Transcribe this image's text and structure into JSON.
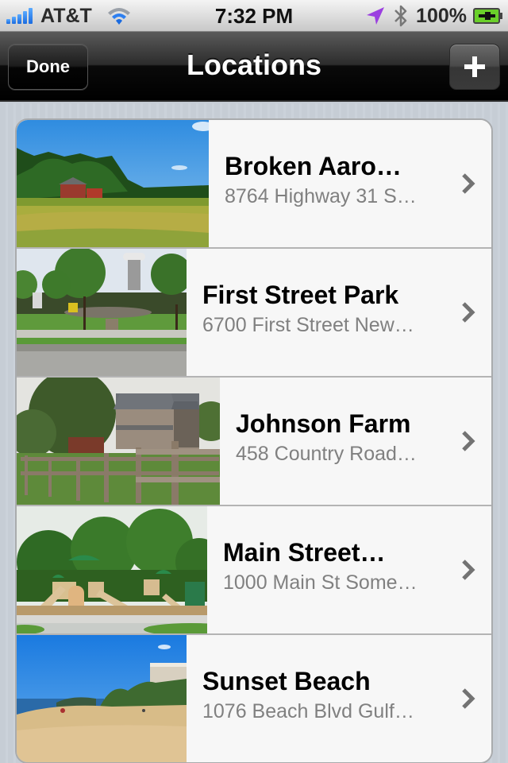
{
  "status_bar": {
    "carrier": "AT&T",
    "time": "7:32 PM",
    "battery_percent": "100%",
    "icons": [
      "signal-bars-icon",
      "wifi-icon",
      "location-arrow-icon",
      "bluetooth-icon",
      "battery-charging-icon"
    ],
    "colors": {
      "signal": "#1a6be0",
      "location": "#9b3fe0",
      "battery": "#5ac81e"
    }
  },
  "nav_bar": {
    "title": "Locations",
    "done_label": "Done",
    "add_icon": "plus-icon"
  },
  "locations": [
    {
      "name": "Broken Aaro…",
      "address": "8764 Highway 31 S…",
      "photo": "field-with-red-barn"
    },
    {
      "name": "First Street Park",
      "address": "6700 First Street New…",
      "photo": "park-with-water-tower"
    },
    {
      "name": "Johnson Farm",
      "address": "458 Country Road…",
      "photo": "farmhouse-with-wooden-fence"
    },
    {
      "name": "Main Street…",
      "address": "1000 Main St Some…",
      "photo": "playground-with-green-canopies"
    },
    {
      "name": "Sunset Beach",
      "address": "1076 Beach Blvd Gulf…",
      "photo": "sandy-beach-with-palms"
    }
  ]
}
